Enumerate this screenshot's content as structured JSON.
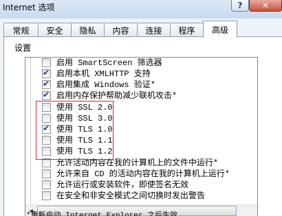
{
  "window": {
    "title": "Internet 选项",
    "help_label": "?",
    "close_label": "✕"
  },
  "tabs": [
    {
      "label": "常规",
      "active": false
    },
    {
      "label": "安全",
      "active": false
    },
    {
      "label": "隐私",
      "active": false
    },
    {
      "label": "内容",
      "active": false
    },
    {
      "label": "连接",
      "active": false
    },
    {
      "label": "程序",
      "active": false
    },
    {
      "label": "高级",
      "active": true
    }
  ],
  "settings_label": "设置",
  "items": [
    {
      "label": "启用 SmartScreen 筛选器",
      "checked": false
    },
    {
      "label": "启用本机 XMLHTTP 支持",
      "checked": true
    },
    {
      "label": "启用集成 Windows 验证*",
      "checked": true
    },
    {
      "label": "启用内存保护帮助减少联机攻击*",
      "checked": true
    },
    {
      "label": "使用 SSL 2.0",
      "checked": false
    },
    {
      "label": "使用 SSL 3.0",
      "checked": false
    },
    {
      "label": "使用 TLS 1.0",
      "checked": true
    },
    {
      "label": "使用 TLS 1.1",
      "checked": false
    },
    {
      "label": "使用 TLS 1.2",
      "checked": false
    },
    {
      "label": "允许活动内容在我的计算机上的文件中运行*",
      "checked": false
    },
    {
      "label": "允许来自 CD 的活动内容在我的计算机上运行*",
      "checked": false
    },
    {
      "label": "允许运行或安装软件，即使签名无效",
      "checked": false
    },
    {
      "label": "在安全和非安全模式之间切换时发出警告",
      "checked": false
    }
  ],
  "footnote": "*重新启动 Internet Explorer 之后生效",
  "colors": {
    "highlight": "#d9242a",
    "check": "#1b3f91"
  }
}
